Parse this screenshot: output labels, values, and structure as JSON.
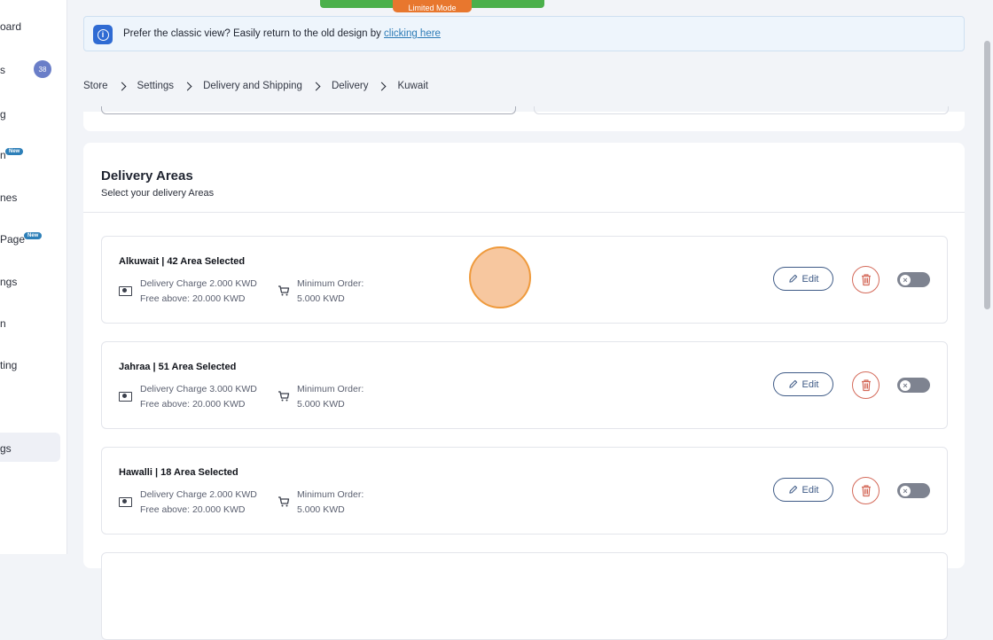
{
  "sidebar": {
    "items": [
      {
        "label": "oard"
      },
      {
        "label": "s",
        "count": "38"
      },
      {
        "label": "g"
      },
      {
        "label": "n",
        "badge": "New"
      },
      {
        "label": "nes"
      },
      {
        "label": "Page",
        "badge": "New"
      },
      {
        "label": "ngs"
      },
      {
        "label": "n"
      },
      {
        "label": "ting"
      },
      {
        "label": "gs",
        "active": true
      }
    ]
  },
  "top_bar": {
    "mode_label": "Limited Mode"
  },
  "banner": {
    "text": "Prefer the classic view? Easily return to the old design by ",
    "link": "clicking here"
  },
  "breadcrumb": [
    "Store",
    "Settings",
    "Delivery and Shipping",
    "Delivery",
    "Kuwait"
  ],
  "delivery_areas": {
    "title": "Delivery Areas",
    "subtitle": "Select your delivery Areas",
    "edit_label": "Edit",
    "rows": [
      {
        "name": "Alkuwait | 42 Area Selected",
        "charge": "Delivery Charge 2.000 KWD",
        "free_above": "Free above: 20.000 KWD",
        "min_label": "Minimum Order:",
        "min_value": "5.000 KWD",
        "enabled": false
      },
      {
        "name": "Jahraa | 51 Area Selected",
        "charge": "Delivery Charge 3.000 KWD",
        "free_above": "Free above: 20.000 KWD",
        "min_label": "Minimum Order:",
        "min_value": "5.000 KWD",
        "enabled": false
      },
      {
        "name": "Hawalli | 18 Area Selected",
        "charge": "Delivery Charge 2.000 KWD",
        "free_above": "Free above: 20.000 KWD",
        "min_label": "Minimum Order:",
        "min_value": "5.000 KWD",
        "enabled": false
      }
    ]
  },
  "colors": {
    "accent_blue": "#2f6bd3",
    "link": "#2c7bb6",
    "edit_border": "#3e5a86",
    "delete_red": "#d46a5a",
    "toggle_off": "#7e8390",
    "limited_green": "#4bb04b",
    "limited_orange": "#e8772e",
    "click_marker": "#f7c79f"
  }
}
